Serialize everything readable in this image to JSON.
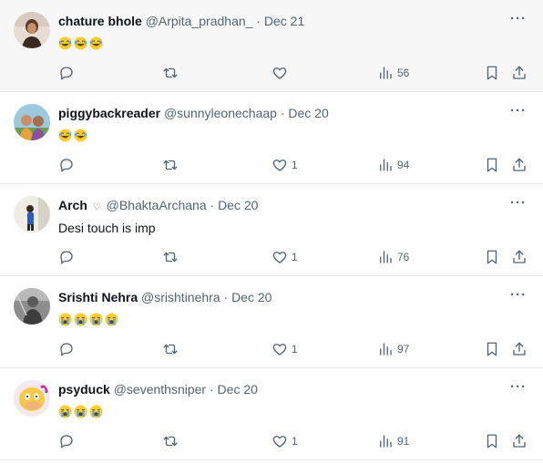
{
  "tweets": [
    {
      "name": "chature bhole",
      "handle": "@Arpita_pradhan_",
      "date": "Dec 21",
      "verified_heart": false,
      "text": "",
      "emoji": [
        "laughing",
        "laughing",
        "laughing"
      ],
      "likes": "",
      "views": "56"
    },
    {
      "name": "piggybackreader",
      "handle": "@sunnyleonechaap",
      "date": "Dec 20",
      "verified_heart": false,
      "text": "",
      "emoji": [
        "laughing",
        "laughing"
      ],
      "likes": "1",
      "views": "94"
    },
    {
      "name": "Arch",
      "handle": "@BhaktaArchana",
      "date": "Dec 20",
      "verified_heart": true,
      "text": "Desi touch is imp",
      "emoji": [],
      "likes": "1",
      "views": "76"
    },
    {
      "name": "Srishti Nehra",
      "handle": "@srishtinehra",
      "date": "Dec 20",
      "verified_heart": false,
      "text": "",
      "emoji": [
        "crying",
        "crying",
        "crying",
        "crying"
      ],
      "likes": "1",
      "views": "97"
    },
    {
      "name": "psyduck",
      "handle": "@seventhsniper",
      "date": "Dec 20",
      "verified_heart": false,
      "text": "",
      "emoji": [
        "crying",
        "crying",
        "crying"
      ],
      "likes": "1",
      "views": "91"
    }
  ],
  "dot_separator": "·",
  "more_label": "···",
  "heart_glyph": "♡",
  "icons": {
    "reply": "reply-icon",
    "retweet": "retweet-icon",
    "like": "heart-icon",
    "views": "views-icon",
    "bookmark": "bookmark-icon",
    "share": "share-icon"
  },
  "colors": {
    "text": "#0f1419",
    "muted": "#536471",
    "divider": "#e6e9ec",
    "emoji_face": "#ffcc33"
  }
}
